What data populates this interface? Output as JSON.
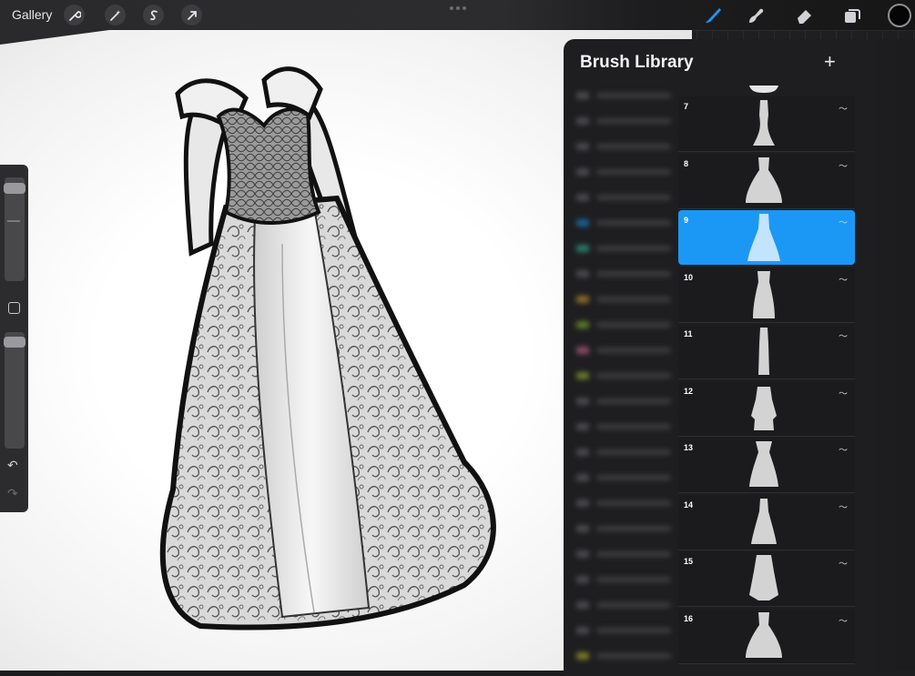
{
  "topbar": {
    "gallery_label": "Gallery",
    "left_tools": [
      "wrench-icon",
      "magic-wand-icon",
      "selection-s-icon",
      "transform-arrow-icon"
    ],
    "right_tools": [
      "brush-icon",
      "smudge-icon",
      "eraser-icon",
      "layers-icon"
    ],
    "accent_color": "#1b98f5",
    "current_color": "#050505"
  },
  "sidebar": {
    "brush_size_level": 0.9,
    "opacity_level": 0.9
  },
  "brush_library": {
    "title": "Brush Library",
    "add_label": "+",
    "brushes": [
      {
        "num": "7",
        "shape": "mermaid"
      },
      {
        "num": "8",
        "shape": "ballgown"
      },
      {
        "num": "9",
        "shape": "flowing",
        "selected": true
      },
      {
        "num": "10",
        "shape": "longsleeve"
      },
      {
        "num": "11",
        "shape": "column"
      },
      {
        "num": "12",
        "shape": "layered"
      },
      {
        "num": "13",
        "shape": "puff"
      },
      {
        "num": "14",
        "shape": "aline"
      },
      {
        "num": "15",
        "shape": "cape"
      },
      {
        "num": "16",
        "shape": "ballgown"
      }
    ]
  }
}
